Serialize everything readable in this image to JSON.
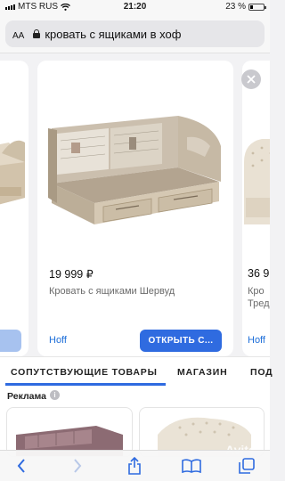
{
  "status_bar": {
    "carrier": "MTS RUS",
    "time": "21:20",
    "battery": "23 %",
    "battery_level": 0.23
  },
  "address_bar": {
    "aa_label": "AA",
    "url_text": "кровать с ящиками в хоф"
  },
  "carousel": {
    "main_card": {
      "price": "19 999 ₽",
      "title": "Кровать с ящиками Шервуд",
      "seller": "Hoff",
      "open_button": "ОТКРЫТЬ С..."
    },
    "right_card": {
      "price": "36 9",
      "title_line1": "Кро",
      "title_line2": "Тред",
      "seller": "Hoff"
    }
  },
  "tabs": [
    {
      "label": "СОПУТСТВУЮЩИЕ ТОВАРЫ"
    },
    {
      "label": "МАГАЗИН"
    },
    {
      "label": "ПОД"
    }
  ],
  "ads_section": {
    "label": "Реклама",
    "info_glyph": "i",
    "watermark": "Avito"
  },
  "colors": {
    "accent": "#2f6be0",
    "seller_link": "#1e6fd9"
  }
}
